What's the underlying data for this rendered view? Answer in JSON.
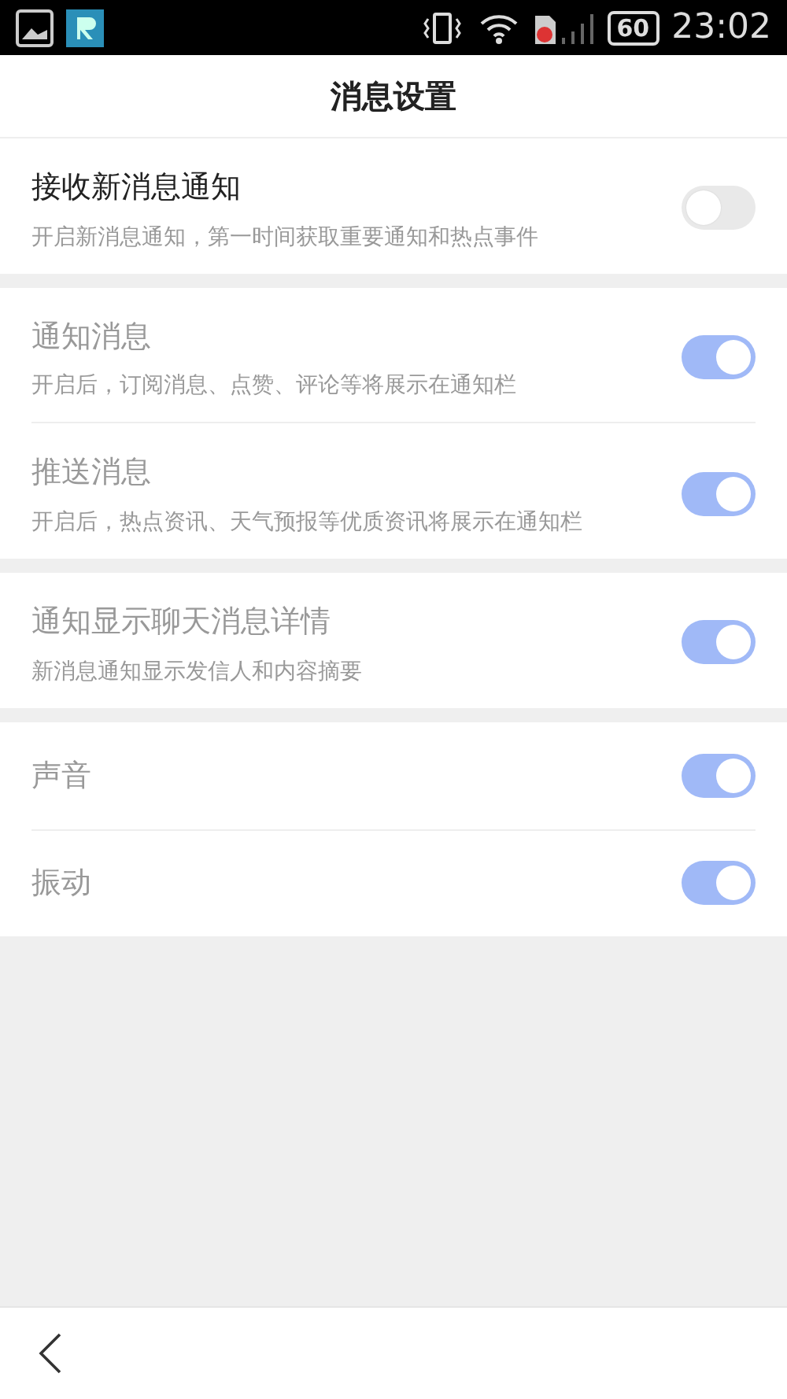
{
  "status_bar": {
    "battery": "60",
    "time": "23:02"
  },
  "title": "消息设置",
  "sections": [
    {
      "items": [
        {
          "title": "接收新消息通知",
          "subtitle": "开启新消息通知，第一时间获取重要通知和热点事件",
          "on": false,
          "disabled": false
        }
      ]
    },
    {
      "items": [
        {
          "title": "通知消息",
          "subtitle": "开启后，订阅消息、点赞、评论等将展示在通知栏",
          "on": true,
          "disabled": true
        },
        {
          "title": "推送消息",
          "subtitle": "开启后，热点资讯、天气预报等优质资讯将展示在通知栏",
          "on": true,
          "disabled": true
        }
      ]
    },
    {
      "items": [
        {
          "title": "通知显示聊天消息详情",
          "subtitle": "新消息通知显示发信人和内容摘要",
          "on": true,
          "disabled": true
        }
      ]
    },
    {
      "items": [
        {
          "title": "声音",
          "on": true,
          "disabled": true
        },
        {
          "title": "振动",
          "on": true,
          "disabled": true
        }
      ]
    }
  ]
}
